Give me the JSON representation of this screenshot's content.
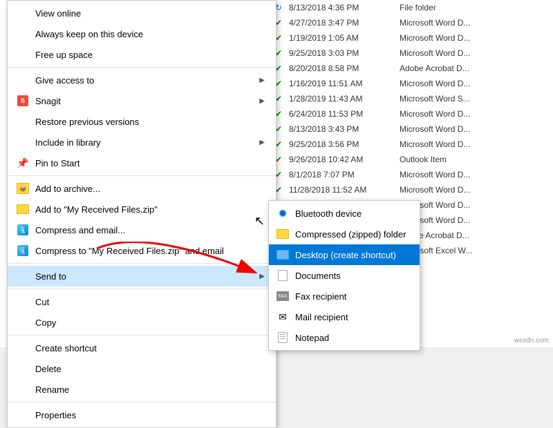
{
  "contextMenu": {
    "items": [
      {
        "id": "view-online",
        "label": "View online",
        "icon": null,
        "hasSub": false
      },
      {
        "id": "always-keep",
        "label": "Always keep on this device",
        "icon": null,
        "hasSub": false
      },
      {
        "id": "free-up",
        "label": "Free up space",
        "icon": null,
        "hasSub": false
      },
      {
        "id": "sep1",
        "type": "separator"
      },
      {
        "id": "give-access",
        "label": "Give access to",
        "icon": null,
        "hasSub": true
      },
      {
        "id": "snagit",
        "label": "Snagit",
        "icon": "snagit",
        "hasSub": true
      },
      {
        "id": "restore",
        "label": "Restore previous versions",
        "icon": null,
        "hasSub": false
      },
      {
        "id": "include-library",
        "label": "Include in library",
        "icon": null,
        "hasSub": true
      },
      {
        "id": "pin-start",
        "label": "Pin to Start",
        "icon": "pin",
        "hasSub": false
      },
      {
        "id": "sep2",
        "type": "separator"
      },
      {
        "id": "add-archive",
        "label": "Add to archive...",
        "icon": "archive",
        "hasSub": false
      },
      {
        "id": "add-zip",
        "label": "Add to \"My Received Files.zip\"",
        "icon": "zip",
        "hasSub": false
      },
      {
        "id": "compress-email",
        "label": "Compress and email...",
        "icon": "compress",
        "hasSub": false
      },
      {
        "id": "compress-zip-email",
        "label": "Compress to \"My Received Files.zip\" and email",
        "icon": "compress2",
        "hasSub": false
      },
      {
        "id": "sep3",
        "type": "separator"
      },
      {
        "id": "send-to",
        "label": "Send to",
        "icon": null,
        "hasSub": true,
        "highlighted": true
      },
      {
        "id": "sep4",
        "type": "separator"
      },
      {
        "id": "cut",
        "label": "Cut",
        "icon": null,
        "hasSub": false
      },
      {
        "id": "copy",
        "label": "Copy",
        "icon": null,
        "hasSub": false
      },
      {
        "id": "sep5",
        "type": "separator"
      },
      {
        "id": "create-shortcut",
        "label": "Create shortcut",
        "icon": null,
        "hasSub": false
      },
      {
        "id": "delete",
        "label": "Delete",
        "icon": null,
        "hasSub": false
      },
      {
        "id": "rename",
        "label": "Rename",
        "icon": null,
        "hasSub": false
      },
      {
        "id": "sep6",
        "type": "separator"
      },
      {
        "id": "properties",
        "label": "Properties",
        "icon": null,
        "hasSub": false
      }
    ]
  },
  "sendToSubmenu": {
    "items": [
      {
        "id": "bluetooth",
        "label": "Bluetooth device",
        "icon": "bluetooth"
      },
      {
        "id": "compressed",
        "label": "Compressed (zipped) folder",
        "icon": "zip-folder"
      },
      {
        "id": "desktop",
        "label": "Desktop (create shortcut)",
        "icon": "desktop",
        "selected": true
      },
      {
        "id": "documents",
        "label": "Documents",
        "icon": "documents"
      },
      {
        "id": "fax",
        "label": "Fax recipient",
        "icon": "fax"
      },
      {
        "id": "mail",
        "label": "Mail recipient",
        "icon": "mail"
      },
      {
        "id": "notepad",
        "label": "Notepad",
        "icon": "notepad"
      }
    ]
  },
  "fileList": {
    "rows": [
      {
        "date": "8/13/2018 4:36 PM",
        "type": "File folder",
        "sync": "blue"
      },
      {
        "date": "4/27/2018 3:47 PM",
        "type": "Microsoft Word D...",
        "sync": "green"
      },
      {
        "date": "1/19/2019 1:05 AM",
        "type": "Microsoft Word D...",
        "sync": "green"
      },
      {
        "date": "9/25/2018 3:03 PM",
        "type": "Microsoft Word D...",
        "sync": "green"
      },
      {
        "date": "8/20/2018 8:58 PM",
        "type": "Adobe Acrobat D...",
        "sync": "green"
      },
      {
        "date": "1/16/2019 11:51 AM",
        "type": "Microsoft Word D...",
        "sync": "green"
      },
      {
        "date": "1/28/2019 11:43 AM",
        "type": "Microsoft Word S...",
        "sync": "green"
      },
      {
        "date": "6/24/2018 11:53 PM",
        "type": "Microsoft Word D...",
        "sync": "green"
      },
      {
        "date": "8/13/2018 3:43 PM",
        "type": "Microsoft Word D...",
        "sync": "green"
      },
      {
        "date": "9/25/2018 3:56 PM",
        "type": "Microsoft Word D...",
        "sync": "green"
      },
      {
        "date": "9/26/2018 10:42 AM",
        "type": "Outlook Item",
        "sync": "green"
      },
      {
        "date": "8/1/2018 7:07 PM",
        "type": "Microsoft Word D...",
        "sync": "green"
      },
      {
        "date": "11/28/2018 11:52 AM",
        "type": "Microsoft Word D...",
        "sync": "green"
      },
      {
        "date": "",
        "type": "Microsoft Word D...",
        "sync": "green"
      },
      {
        "date": "",
        "type": "Microsoft Word D...",
        "sync": "green"
      },
      {
        "date": "",
        "type": "Adobe Acrobat D...",
        "sync": "green"
      },
      {
        "date": "",
        "type": "Microsoft Excel W...",
        "sync": "green"
      }
    ]
  },
  "watermark": "wsxdn.com"
}
